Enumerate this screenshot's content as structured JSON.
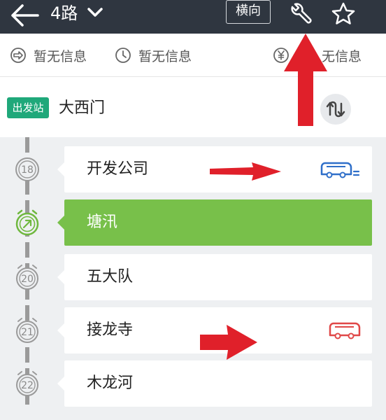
{
  "header": {
    "title": "4路",
    "landscape_label": "横向"
  },
  "info": {
    "items": [
      {
        "label": "暂无信息",
        "icon": "direction-icon"
      },
      {
        "label": "暂无信息",
        "icon": "clock-icon"
      },
      {
        "label": "无信息",
        "icon": "yuan-icon"
      }
    ]
  },
  "departure": {
    "badge": "出发站",
    "station": "大西门"
  },
  "stations": [
    {
      "num": "18",
      "name": "开发公司"
    },
    {
      "num": "",
      "name": "塘汛"
    },
    {
      "num": "20",
      "name": "五大队"
    },
    {
      "num": "21",
      "name": "接龙寺"
    },
    {
      "num": "22",
      "name": "木龙河"
    }
  ],
  "colors": {
    "header_bg": "#2f3640",
    "active_station": "#78c04a",
    "depart_badge": "#1fa87a",
    "bus_blue": "#2f6fc9",
    "bus_red": "#e04848",
    "annotation_arrow": "#e0202a"
  }
}
